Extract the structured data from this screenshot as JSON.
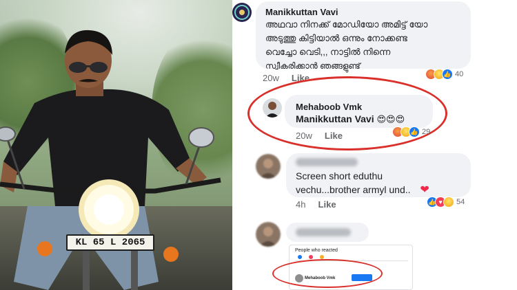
{
  "photo": {
    "plate_text": "KL 65 L 2065"
  },
  "comments": [
    {
      "author": "Manikkuttan Vavi",
      "lines": [
        "അഥവാ നിനക്ക് മോഡിയോ അമിട്ട് യോ",
        "അടുത്തു കിട്ടിയാൽ ഒന്നും നോക്കണ്ട",
        "വെച്ചോ  വെടി,,, നാട്ടിൽ നിന്നെ",
        "സ്വീകരിക്കാൻ ഞങ്ങളുണ്ട്"
      ],
      "time": "20w",
      "like_label": "Like",
      "reaction_count": "40",
      "reactions": [
        "angry-icon",
        "laugh-icon",
        "like-icon"
      ]
    },
    {
      "author": "Mehaboob Vmk",
      "reply_text": "Manikkuttan Vavi",
      "emoji": "😍😍😍",
      "time": "20w",
      "like_label": "Like",
      "reaction_count": "29",
      "reactions": [
        "angry-icon",
        "laugh-icon",
        "like-icon"
      ]
    },
    {
      "lines": [
        "Screen short eduthu",
        "vechu...brother armyl und.."
      ],
      "heart": "❤",
      "time": "4h",
      "like_label": "Like",
      "reaction_count": "54",
      "reactions": [
        "like-icon",
        "love-icon",
        "laugh-icon"
      ]
    }
  ],
  "embedded_screenshot": {
    "title": "People who reacted",
    "name": "Mehaboob Vmk"
  },
  "colors": {
    "highlight_ring": "#d9302b",
    "bubble": "#f0f2f5",
    "link_blue": "#1877f2"
  }
}
